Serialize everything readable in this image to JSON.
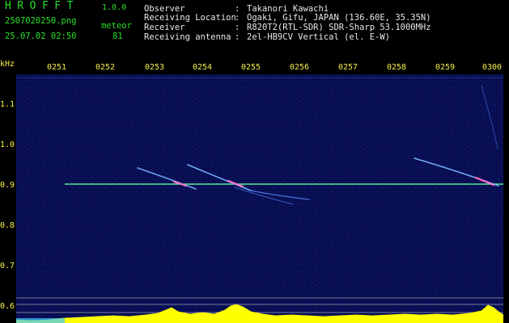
{
  "app": {
    "title": "HROFFT",
    "version": "1.0.0"
  },
  "capture": {
    "file_name": "2507020250.png",
    "timestamp": "25.07.02 02:50",
    "detection_label": "meteor",
    "detection_count": "81"
  },
  "station": {
    "rows": [
      {
        "label": "Observer",
        "value": "Takanori Kawachi"
      },
      {
        "label": "Receiving Location",
        "value": "Ogaki, Gifu, JAPAN (136.60E, 35.35N)"
      },
      {
        "label": "Receiver",
        "value": "R820T2(RTL-SDR) SDR-Sharp 53.1000MHz"
      },
      {
        "label": "Receiving antenna",
        "value": "2el-HB9CV Vertical (el. E-W)"
      }
    ],
    "separator": ":"
  },
  "colors": {
    "header_text": "#28e028",
    "meta_text": "#e8e8e8",
    "axis_text": "#f5f04a",
    "background": "#050a46",
    "carrier_line": "#50e8a0",
    "echo_trace": "#78b4ff",
    "power_trace": "#ffff00"
  },
  "spectrogram": {
    "freq_unit": "kHz",
    "freq_ticks": [
      "1.1",
      "1.0",
      "0.9",
      "0.8",
      "0.7",
      "0.6"
    ],
    "time_ticks": [
      "0251",
      "0252",
      "0253",
      "0254",
      "0255",
      "0256",
      "0257",
      "0258",
      "0259",
      "0300"
    ]
  }
}
